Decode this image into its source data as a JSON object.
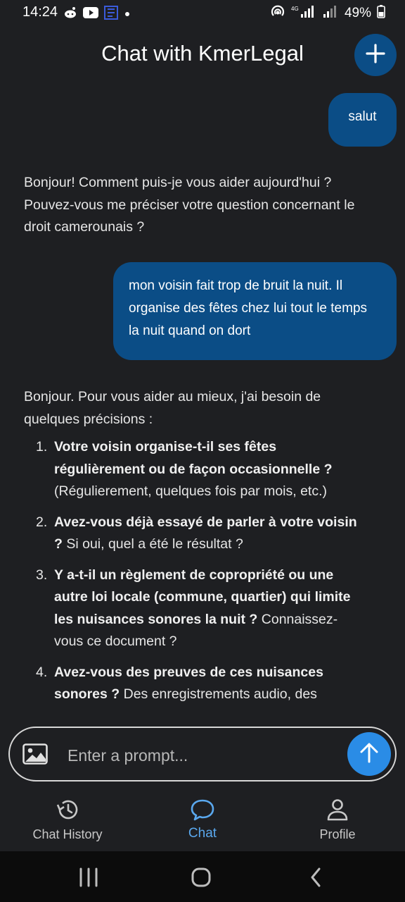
{
  "status_bar": {
    "time": "14:24",
    "battery": "49%",
    "network": "4G",
    "icons": [
      "reddit-icon",
      "youtube-icon",
      "app-icon",
      "dot-icon",
      "hotspot-icon",
      "signal-icon",
      "signal-roaming-icon",
      "battery-icon"
    ]
  },
  "header": {
    "title": "Chat with KmerLegal",
    "new_chat_icon": "plus-icon"
  },
  "messages": {
    "user_1": "salut",
    "bot_1": "Bonjour! Comment puis-je vous aider aujourd'hui ?  Pouvez-vous me préciser votre question concernant le droit camerounais ?",
    "user_2": "mon voisin fait trop de bruit la nuit. Il organise des fêtes chez lui tout le temps la nuit quand on dort",
    "bot_2": {
      "intro": "Bonjour.  Pour vous aider au mieux, j'ai besoin de quelques précisions :",
      "items": [
        {
          "num": "1.",
          "bold": "Votre voisin organise-t-il ses fêtes régulièrement ou de façon occasionnelle ?",
          "rest": " (Régulierement, quelques fois par mois, etc.)"
        },
        {
          "num": "2.",
          "bold": "Avez-vous déjà essayé de parler à votre voisin ?",
          "rest": "  Si oui, quel a été le résultat ?"
        },
        {
          "num": "3.",
          "bold": "Y a-t-il un règlement de copropriété ou une autre loi locale (commune, quartier) qui limite les nuisances sonores la nuit ?",
          "rest": "  Connaissez-vous ce document ?"
        },
        {
          "num": "4.",
          "bold": "Avez-vous des preuves de ces nuisances sonores ?",
          "rest": "  Des enregistrements audio, des"
        }
      ]
    }
  },
  "input": {
    "placeholder": "Enter a prompt...",
    "image_icon": "image-icon",
    "send_icon": "arrow-up-icon"
  },
  "bottom_nav": {
    "items": [
      {
        "label": "Chat History",
        "icon": "history-icon",
        "active": false
      },
      {
        "label": "Chat",
        "icon": "chat-bubble-icon",
        "active": true
      },
      {
        "label": "Profile",
        "icon": "person-icon",
        "active": false
      }
    ]
  },
  "colors": {
    "background": "#1e1f22",
    "bubble": "#0b4d86",
    "accent": "#2a8ce6",
    "active_nav": "#5aa8ee"
  }
}
